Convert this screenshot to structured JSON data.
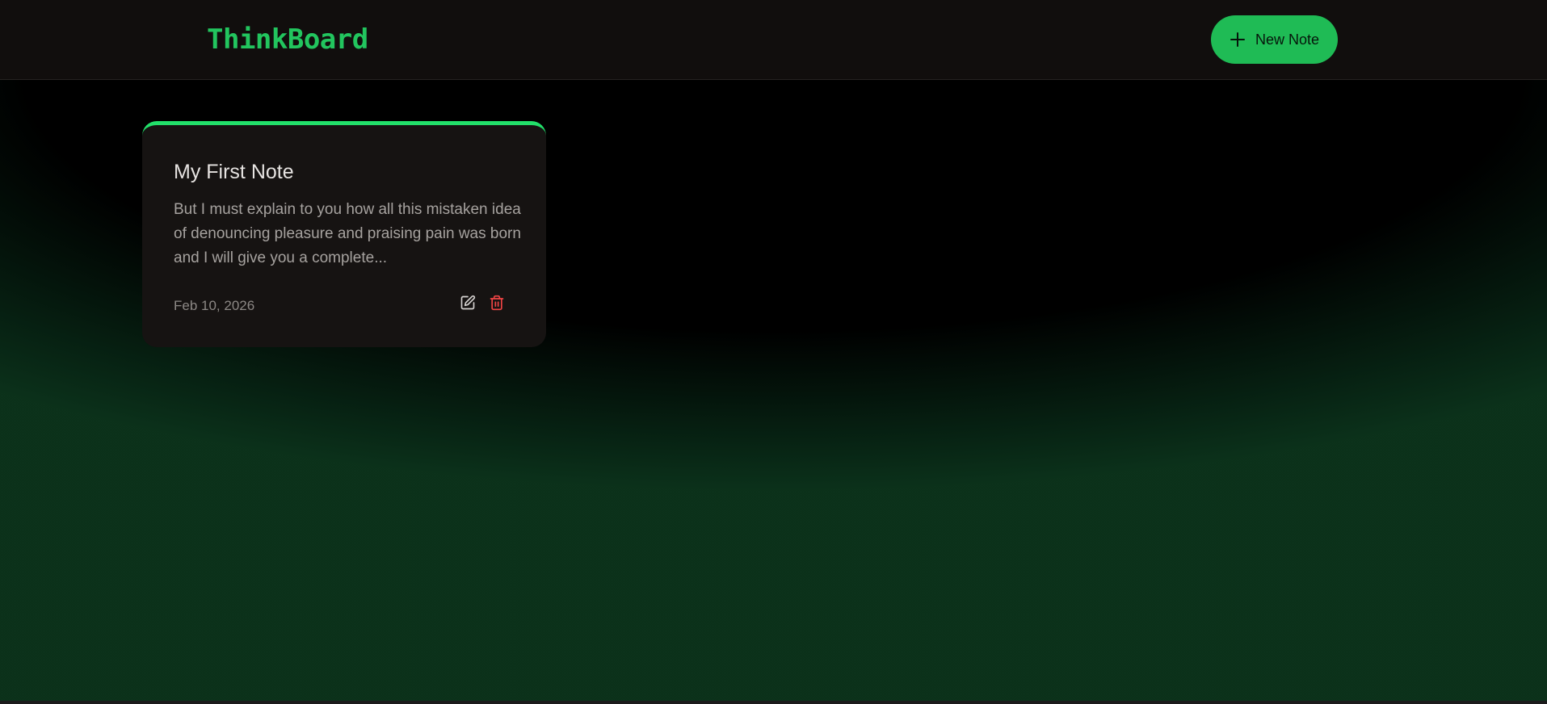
{
  "header": {
    "brand": "ThinkBoard",
    "new_note_label": "New Note"
  },
  "notes": [
    {
      "title": "My First Note",
      "content": "But I must explain to you how all this mistaken idea of denouncing pleasure and praising pain was born and I will give you a complete...",
      "date": "Feb 10, 2026"
    }
  ],
  "icons": {
    "new_note": "plus-icon",
    "edit": "edit-icon",
    "delete": "trash-icon"
  },
  "colors": {
    "accent": "#22c55e",
    "accent_bright": "#22e06a",
    "danger": "#ef4444",
    "header_bg": "#110e0d",
    "card_bg": "#161312"
  }
}
